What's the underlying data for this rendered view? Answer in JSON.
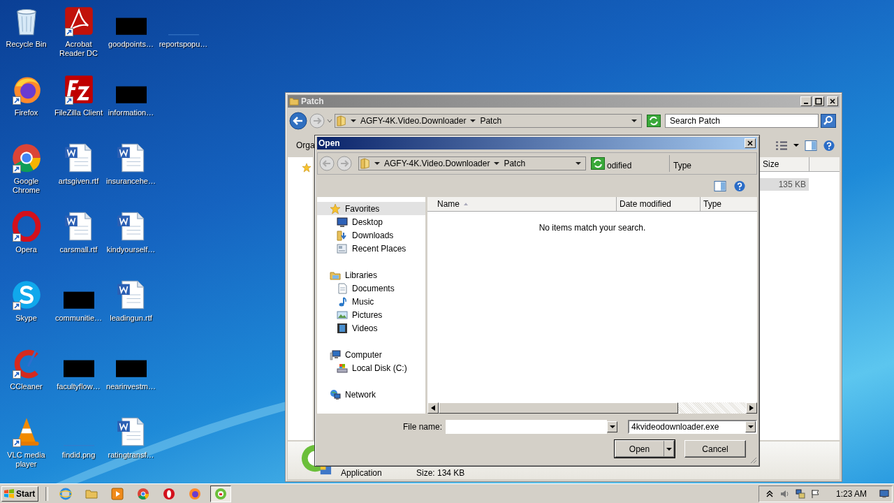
{
  "desktop_icons": [
    {
      "label": "Recycle Bin",
      "kind": "recycle-bin",
      "shortcut": false
    },
    {
      "label": "Firefox",
      "kind": "firefox",
      "shortcut": true
    },
    {
      "label": "Google Chrome",
      "kind": "chrome",
      "shortcut": true
    },
    {
      "label": "Opera",
      "kind": "opera",
      "shortcut": true
    },
    {
      "label": "Skype",
      "kind": "skype",
      "shortcut": true
    },
    {
      "label": "CCleaner",
      "kind": "ccleaner",
      "shortcut": true
    },
    {
      "label": "VLC media player",
      "kind": "vlc",
      "shortcut": true
    },
    {
      "label": "Acrobat Reader DC",
      "kind": "acrobat",
      "shortcut": true
    },
    {
      "label": "FileZilla Client",
      "kind": "filezilla",
      "shortcut": true
    },
    {
      "label": "artsgiven.rtf",
      "kind": "document",
      "shortcut": false
    },
    {
      "label": "carsmall.rtf",
      "kind": "document",
      "shortcut": false
    },
    {
      "label": "communitie…",
      "kind": "redacted",
      "shortcut": false
    },
    {
      "label": "facultyflow…",
      "kind": "redacted",
      "shortcut": false
    },
    {
      "label": "findid.png",
      "kind": "blank",
      "shortcut": false
    },
    {
      "label": "goodpoints…",
      "kind": "redacted",
      "shortcut": false
    },
    {
      "label": "information…",
      "kind": "redacted",
      "shortcut": false
    },
    {
      "label": "insurancehe…",
      "kind": "document",
      "shortcut": false
    },
    {
      "label": "kindyourself…",
      "kind": "document",
      "shortcut": false
    },
    {
      "label": "leadingun.rtf",
      "kind": "document",
      "shortcut": false
    },
    {
      "label": "nearinvestm…",
      "kind": "redacted",
      "shortcut": false
    },
    {
      "label": "ratingtransf…",
      "kind": "document",
      "shortcut": false
    },
    {
      "label": "reportspopu…",
      "kind": "blank",
      "shortcut": false
    }
  ],
  "explorer": {
    "title": "Patch",
    "breadcrumb": [
      "AGFY-4K.Video.Downloader",
      "Patch"
    ],
    "search": {
      "placeholder": "Search Patch"
    },
    "toolbar_label": "Orga",
    "columns": [
      "Size"
    ],
    "rows": [
      {
        "size": "135 KB",
        "selected": true
      }
    ],
    "details": {
      "type": "Application",
      "size": "Size: 134 KB"
    }
  },
  "dialog": {
    "title": "Open",
    "breadcrumb": [
      "AGFY-4K.Video.Downloader",
      "Patch"
    ],
    "stray_headers": [
      "odified",
      "Type"
    ],
    "nav": [
      {
        "label": "Favorites",
        "selected": true,
        "children": [
          {
            "label": "Desktop",
            "selected": false
          },
          {
            "label": "Downloads",
            "selected": false
          },
          {
            "label": "Recent Places",
            "selected": false
          }
        ]
      },
      {
        "label": "Libraries",
        "selected": false,
        "children": [
          {
            "label": "Documents",
            "selected": false
          },
          {
            "label": "Music",
            "selected": false
          },
          {
            "label": "Pictures",
            "selected": false
          },
          {
            "label": "Videos",
            "selected": false
          }
        ]
      },
      {
        "label": "Computer",
        "selected": false,
        "children": [
          {
            "label": "Local Disk (C:)",
            "selected": false
          }
        ]
      },
      {
        "label": "Network",
        "selected": false
      }
    ],
    "columns": [
      {
        "label": "Name",
        "sorted": true
      },
      {
        "label": "Date modified",
        "sorted": false
      },
      {
        "label": "Type",
        "sorted": false
      }
    ],
    "empty_message": "No items match your search.",
    "file_name_label": "File name:",
    "filter": "4kvideodownloader.exe",
    "buttons": [
      "Open",
      "Cancel"
    ]
  },
  "taskbar": {
    "start": "Start",
    "apps": [
      {
        "kind": "ie",
        "selected": false
      },
      {
        "kind": "folder",
        "selected": false
      },
      {
        "kind": "media",
        "selected": false
      },
      {
        "kind": "chrome",
        "selected": false
      },
      {
        "kind": "opera",
        "selected": false
      },
      {
        "kind": "firefox",
        "selected": false
      },
      {
        "kind": "downloader",
        "selected": true
      }
    ],
    "clock": "1:23 AM"
  }
}
